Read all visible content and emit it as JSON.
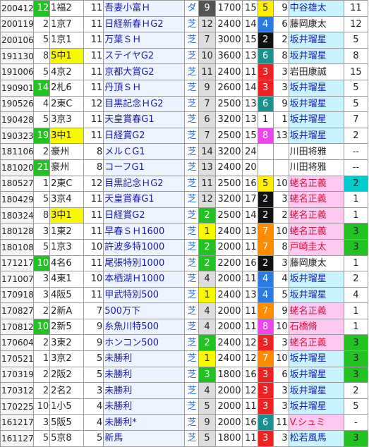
{
  "colors": {
    "green_rank": "#22c222",
    "yellow_course": "#f8f800",
    "race_text": "#1a1aa8",
    "gate_1": "#ffffff",
    "gate_2": "#111111",
    "gate_3": "#ee2222",
    "gate_4": "#2a7ae2",
    "gate_5": "#ffee00",
    "gate_6": "#1a9090",
    "gate_7": "#ff8c00",
    "gate_8": "#ee44ee",
    "jockey_pink": "#ffc8f0",
    "jockey_cyan": "#c8f4ff"
  },
  "rows": [
    {
      "date": "200412",
      "rank": "12",
      "rank_hl": true,
      "course": "1福2",
      "course_hl": false,
      "nm": "11",
      "race": "吾妻小富Ｈ",
      "track": "ダ",
      "ban": "9",
      "ban_bg": "#555555",
      "ban_fg": "#ffffff",
      "dist": "1700",
      "hs": "15",
      "gate": "5",
      "gate_bg": "#ffee00",
      "gate_fg": "#222222",
      "umaban": "9",
      "jockey": "中谷雄太",
      "jockey_style": "cyan",
      "fin": "11",
      "fin_style": "wh"
    },
    {
      "date": "200119",
      "rank": "2",
      "rank_hl": false,
      "course": "1京7",
      "course_hl": false,
      "nm": "11",
      "race": "日経新春ＨG2",
      "track": "芝",
      "ban": "12",
      "ban_bg": "#dddddd",
      "ban_fg": "#222222",
      "dist": "2400",
      "hs": "14",
      "gate": "4",
      "gate_bg": "#2a7ae2",
      "gate_fg": "#ffffff",
      "umaban": "6",
      "jockey": "藤岡康太",
      "jockey_style": "dark",
      "fin": "12",
      "fin_style": "wh"
    },
    {
      "date": "200106",
      "rank": "5",
      "rank_hl": false,
      "course": "1京1",
      "course_hl": false,
      "nm": "11",
      "race": "万葉ＳＨ",
      "track": "芝",
      "ban": "7",
      "ban_bg": "#dddddd",
      "ban_fg": "#222222",
      "dist": "3000",
      "hs": "15",
      "gate": "2",
      "gate_bg": "#111111",
      "gate_fg": "#ffffff",
      "umaban": "2",
      "jockey": "坂井瑠星",
      "jockey_style": "cyan",
      "fin": "5",
      "fin_style": "wh"
    },
    {
      "date": "191130",
      "rank": "8",
      "rank_hl": false,
      "course": "5中1",
      "course_hl": true,
      "nm": "11",
      "race": "ステイヤG2",
      "track": "芝",
      "ban": "10",
      "ban_bg": "#dddddd",
      "ban_fg": "#222222",
      "dist": "3600",
      "hs": "13",
      "gate": "6",
      "gate_bg": "#1a9090",
      "gate_fg": "#ffffff",
      "umaban": "8",
      "jockey": "坂井瑠星",
      "jockey_style": "cyan",
      "fin": "8",
      "fin_style": "wh"
    },
    {
      "date": "191006",
      "rank": "5",
      "rank_hl": false,
      "course": "4京2",
      "course_hl": false,
      "nm": "11",
      "race": "京都大賞G2",
      "track": "芝",
      "ban": "11",
      "ban_bg": "#dddddd",
      "ban_fg": "#222222",
      "dist": "2400",
      "hs": "11",
      "gate": "3",
      "gate_bg": "#ee2222",
      "gate_fg": "#ffffff",
      "umaban": "3",
      "jockey": "岩田康誠",
      "jockey_style": "dark",
      "fin": "15",
      "fin_style": "wh"
    },
    {
      "date": "190901",
      "rank": "14",
      "rank_hl": true,
      "course": "2札6",
      "course_hl": false,
      "nm": "11",
      "race": "丹頂ＳＨ",
      "track": "芝",
      "ban": "9",
      "ban_bg": "#dddddd",
      "ban_fg": "#222222",
      "dist": "2600",
      "hs": "14",
      "gate": "3",
      "gate_bg": "#ee2222",
      "gate_fg": "#ffffff",
      "umaban": "3",
      "jockey": "坂井瑠星",
      "jockey_style": "cyan",
      "fin": "5",
      "fin_style": "wh"
    },
    {
      "date": "190526",
      "rank": "4",
      "rank_hl": false,
      "course": "2東C",
      "course_hl": false,
      "nm": "12",
      "race": "目黒記念ＨG2",
      "track": "芝",
      "ban": "7",
      "ban_bg": "#dddddd",
      "ban_fg": "#222222",
      "dist": "2500",
      "hs": "13",
      "gate": "6",
      "gate_bg": "#1a9090",
      "gate_fg": "#ffffff",
      "umaban": "9",
      "jockey": "坂井瑠星",
      "jockey_style": "cyan",
      "fin": "5",
      "fin_style": "wh"
    },
    {
      "date": "190428",
      "rank": "5",
      "rank_hl": false,
      "course": "3京3",
      "course_hl": false,
      "nm": "11",
      "race": "天皇賞春G1",
      "track": "芝",
      "ban": "6",
      "ban_bg": "#dddddd",
      "ban_fg": "#222222",
      "dist": "3200",
      "hs": "13",
      "gate": "1",
      "gate_bg": "#ffffff",
      "gate_fg": "#222222",
      "umaban": "1",
      "jockey": "坂井瑠星",
      "jockey_style": "cyan",
      "fin": "7",
      "fin_style": "wh"
    },
    {
      "date": "190323",
      "rank": "19",
      "rank_hl": true,
      "course": "3中1",
      "course_hl": true,
      "nm": "11",
      "race": "日経賞G2",
      "track": "芝",
      "ban": "7",
      "ban_bg": "#dddddd",
      "ban_fg": "#222222",
      "dist": "2500",
      "hs": "15",
      "gate": "8",
      "gate_bg": "#ee44ee",
      "gate_fg": "#ffffff",
      "umaban": "13",
      "jockey": "坂井瑠星",
      "jockey_style": "cyan",
      "fin": "2",
      "fin_style": "wh"
    },
    {
      "date": "181106",
      "rank": "2",
      "rank_hl": false,
      "course": "豪州",
      "course_hl": false,
      "nm": "8",
      "race": "メルＣG1",
      "track": "芝",
      "ban": "14",
      "ban_bg": "#dddddd",
      "ban_fg": "#222222",
      "dist": "3200",
      "hs": "24",
      "gate": "",
      "gate_bg": "#ffffff",
      "gate_fg": "#222222",
      "umaban": "",
      "jockey": "川田将雅",
      "jockey_style": "dark",
      "fin": "--",
      "fin_style": "wh"
    },
    {
      "date": "181020",
      "rank": "21",
      "rank_hl": true,
      "course": "豪州",
      "course_hl": false,
      "nm": "8",
      "race": "コーフG1",
      "track": "芝",
      "ban": "13",
      "ban_bg": "#dddddd",
      "ban_fg": "#222222",
      "dist": "2400",
      "hs": "20",
      "gate": "",
      "gate_bg": "#ffffff",
      "gate_fg": "#222222",
      "umaban": "",
      "jockey": "川田将雅",
      "jockey_style": "dark",
      "fin": "--",
      "fin_style": "wh"
    },
    {
      "date": "180527",
      "rank": "1",
      "rank_hl": false,
      "course": "2東C",
      "course_hl": false,
      "nm": "12",
      "race": "目黒記念ＨG2",
      "track": "芝",
      "ban": "11",
      "ban_bg": "#dddddd",
      "ban_fg": "#222222",
      "dist": "2500",
      "hs": "16",
      "gate": "5",
      "gate_bg": "#ffee00",
      "gate_fg": "#222222",
      "umaban": "10",
      "jockey": "蛯名正義",
      "jockey_style": "pink",
      "fin": "2",
      "fin_style": "cy"
    },
    {
      "date": "180429",
      "rank": "5",
      "rank_hl": false,
      "course": "3京4",
      "course_hl": false,
      "nm": "11",
      "race": "天皇賞春G1",
      "track": "芝",
      "ban": "12",
      "ban_bg": "#dddddd",
      "ban_fg": "#222222",
      "dist": "3200",
      "hs": "17",
      "gate": "2",
      "gate_bg": "#111111",
      "gate_fg": "#ffffff",
      "umaban": "3",
      "jockey": "蛯名正義",
      "jockey_style": "pink",
      "fin": "1",
      "fin_style": "wh"
    },
    {
      "date": "180324",
      "rank": "8",
      "rank_hl": false,
      "course": "3中1",
      "course_hl": true,
      "nm": "11",
      "race": "日経賞G2",
      "track": "芝",
      "ban": "2",
      "ban_bg": "#22c222",
      "ban_fg": "#ffffff",
      "dist": "2500",
      "hs": "14",
      "gate": "2",
      "gate_bg": "#111111",
      "gate_fg": "#ffffff",
      "umaban": "2",
      "jockey": "蛯名正義",
      "jockey_style": "pink",
      "fin": "1",
      "fin_style": "wh"
    },
    {
      "date": "180128",
      "rank": "3",
      "rank_hl": false,
      "course": "1東2",
      "course_hl": false,
      "nm": "11",
      "race": "早春ＳＨ1600",
      "track": "芝",
      "ban": "1",
      "ban_bg": "#f8f800",
      "ban_fg": "#222222",
      "dist": "2400",
      "hs": "13",
      "gate": "7",
      "gate_bg": "#ff8c00",
      "gate_fg": "#ffffff",
      "umaban": "10",
      "jockey": "蛯名正義",
      "jockey_style": "pink",
      "fin": "3",
      "fin_style": "gr"
    },
    {
      "date": "180108",
      "rank": "5",
      "rank_hl": false,
      "course": "1京3",
      "course_hl": false,
      "nm": "10",
      "race": "許波多特1000",
      "track": "芝",
      "ban": "2",
      "ban_bg": "#22c222",
      "ban_fg": "#ffffff",
      "dist": "2000",
      "hs": "11",
      "gate": "7",
      "gate_bg": "#ff8c00",
      "gate_fg": "#ffffff",
      "umaban": "8",
      "jockey": "戸崎圭太",
      "jockey_style": "pink",
      "fin": "3",
      "fin_style": "gr"
    },
    {
      "date": "171217",
      "rank": "10",
      "rank_hl": true,
      "course": "4名6",
      "course_hl": false,
      "nm": "11",
      "race": "尾張特別1000",
      "track": "芝",
      "ban": "2",
      "ban_bg": "#22c222",
      "ban_fg": "#ffffff",
      "dist": "2200",
      "hs": "16",
      "gate": "2",
      "gate_bg": "#111111",
      "gate_fg": "#ffffff",
      "umaban": "3",
      "jockey": "藤岡康太",
      "jockey_style": "dark",
      "fin": "1",
      "fin_style": "wh"
    },
    {
      "date": "171007",
      "rank": "3",
      "rank_hl": false,
      "course": "4東1",
      "course_hl": false,
      "nm": "10",
      "race": "本栖湖Ｈ1000",
      "track": "芝",
      "ban": "4",
      "ban_bg": "#dddddd",
      "ban_fg": "#222222",
      "dist": "2000",
      "hs": "11",
      "gate": "4",
      "gate_bg": "#2a7ae2",
      "gate_fg": "#ffffff",
      "umaban": "4",
      "jockey": "坂井瑠星",
      "jockey_style": "cyan",
      "fin": "2",
      "fin_style": "wh"
    },
    {
      "date": "170918",
      "rank": "3",
      "rank_hl": false,
      "course": "4阪5",
      "course_hl": false,
      "nm": "11",
      "race": "甲武特別500",
      "track": "芝",
      "ban": "1",
      "ban_bg": "#f8f800",
      "ban_fg": "#222222",
      "dist": "2400",
      "hs": "13",
      "gate": "4",
      "gate_bg": "#2a7ae2",
      "gate_fg": "#ffffff",
      "umaban": "5",
      "jockey": "坂井瑠星",
      "jockey_style": "cyan",
      "fin": "4",
      "fin_style": "wh"
    },
    {
      "date": "170827",
      "rank": "2",
      "rank_hl": false,
      "course": "2新A",
      "course_hl": false,
      "nm": "7",
      "race": "500万下",
      "track": "芝",
      "ban": "4",
      "ban_bg": "#dddddd",
      "ban_fg": "#222222",
      "dist": "2000",
      "hs": "11",
      "gate": "7",
      "gate_bg": "#ff8c00",
      "gate_fg": "#ffffff",
      "umaban": "9",
      "jockey": "蛯名正義",
      "jockey_style": "pink",
      "fin": "1",
      "fin_style": "wh"
    },
    {
      "date": "170812",
      "rank": "10",
      "rank_hl": true,
      "course": "2新5",
      "course_hl": false,
      "nm": "9",
      "race": "糸魚川特500",
      "track": "芝",
      "ban": "4",
      "ban_bg": "#dddddd",
      "ban_fg": "#222222",
      "dist": "2000",
      "hs": "11",
      "gate": "8",
      "gate_bg": "#ee44ee",
      "gate_fg": "#ffffff",
      "umaban": "10",
      "jockey": "石橋脩",
      "jockey_style": "pink",
      "fin": "1",
      "fin_style": "wh"
    },
    {
      "date": "170604",
      "rank": "2",
      "rank_hl": false,
      "course": "3東2",
      "course_hl": false,
      "nm": "9",
      "race": "ホンコン500",
      "track": "芝",
      "ban": "2",
      "ban_bg": "#22c222",
      "ban_fg": "#ffffff",
      "dist": "2400",
      "hs": "12",
      "gate": "3",
      "gate_bg": "#ee2222",
      "gate_fg": "#ffffff",
      "umaban": "3",
      "jockey": "蛯名正義",
      "jockey_style": "pink",
      "fin": "3",
      "fin_style": "gr"
    },
    {
      "date": "170521",
      "rank": "1",
      "rank_hl": false,
      "course": "3京2",
      "course_hl": false,
      "nm": "5",
      "race": "未勝利",
      "track": "芝",
      "ban": "1",
      "ban_bg": "#f8f800",
      "ban_fg": "#222222",
      "dist": "2400",
      "hs": "12",
      "gate": "7",
      "gate_bg": "#ff8c00",
      "gate_fg": "#ffffff",
      "umaban": "10",
      "jockey": "坂井瑠星",
      "jockey_style": "cyan",
      "fin": "3",
      "fin_style": "gr"
    },
    {
      "date": "170319",
      "rank": "2",
      "rank_hl": false,
      "course": "2阪2",
      "course_hl": false,
      "nm": "5",
      "race": "未勝利",
      "track": "芝",
      "ban": "3",
      "ban_bg": "#22c222",
      "ban_fg": "#ffffff",
      "dist": "1800",
      "hs": "16",
      "gate": "3",
      "gate_bg": "#ee2222",
      "gate_fg": "#ffffff",
      "umaban": "6",
      "jockey": "坂井瑠星",
      "jockey_style": "cyan",
      "fin": "3",
      "fin_style": "gr"
    },
    {
      "date": "170312",
      "rank": "2",
      "rank_hl": false,
      "course": "2名2",
      "course_hl": false,
      "nm": "3",
      "race": "未勝利",
      "track": "芝",
      "ban": "4",
      "ban_bg": "#dddddd",
      "ban_fg": "#222222",
      "dist": "2000",
      "hs": "12",
      "gate": "3",
      "gate_bg": "#ee2222",
      "gate_fg": "#ffffff",
      "umaban": "3",
      "jockey": "坂井瑠星",
      "jockey_style": "cyan",
      "fin": "2",
      "fin_style": "wh"
    },
    {
      "date": "170225",
      "rank": "10",
      "rank_hl": false,
      "course": "1小5",
      "course_hl": false,
      "nm": "4",
      "race": "未勝利",
      "track": "芝",
      "ban": "5",
      "ban_bg": "#dddddd",
      "ban_fg": "#222222",
      "dist": "2000",
      "hs": "11",
      "gate": "3",
      "gate_bg": "#ee2222",
      "gate_fg": "#ffffff",
      "umaban": "3",
      "jockey": "坂井瑠星",
      "jockey_style": "cyan",
      "fin": "5",
      "fin_style": "wh"
    },
    {
      "date": "161217",
      "rank": "3",
      "rank_hl": false,
      "course": "5阪5",
      "course_hl": false,
      "nm": "4",
      "race": "未勝利*",
      "track": "芝",
      "ban": "9",
      "ban_bg": "#dddddd",
      "ban_fg": "#222222",
      "dist": "2000",
      "hs": "16",
      "gate": "6",
      "gate_bg": "#1a9090",
      "gate_fg": "#ffffff",
      "umaban": "11",
      "jockey": "V.シュミ",
      "jockey_style": "pink",
      "fin": "-",
      "fin_style": "wh"
    },
    {
      "date": "161127",
      "rank": "5",
      "rank_hl": false,
      "course": "5京8",
      "course_hl": false,
      "nm": "5",
      "race": "新馬",
      "track": "芝",
      "ban": "5",
      "ban_bg": "#dddddd",
      "ban_fg": "#222222",
      "dist": "1800",
      "hs": "11",
      "gate": "3",
      "gate_bg": "#ee2222",
      "gate_fg": "#ffffff",
      "umaban": "3",
      "jockey": "松若風馬",
      "jockey_style": "cyan",
      "fin": "3",
      "fin_style": "gr"
    }
  ]
}
